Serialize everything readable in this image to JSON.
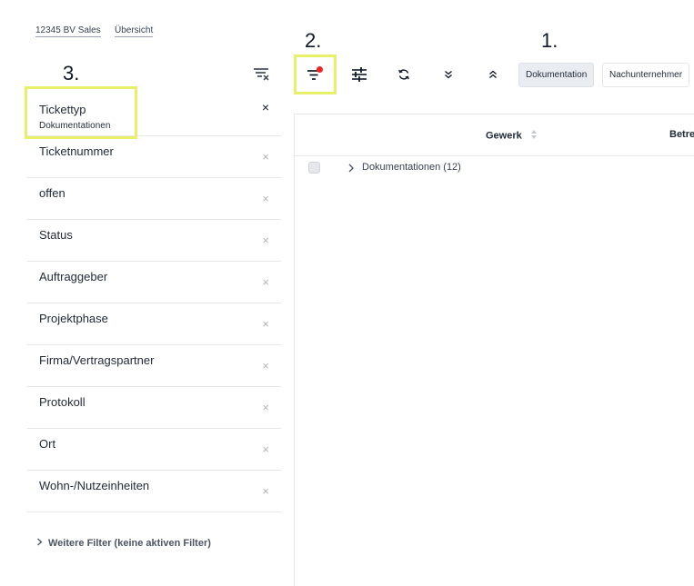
{
  "breadcrumb": [
    "12345 BV Sales",
    "Übersicht"
  ],
  "annotations": {
    "one": "1.",
    "two": "2.",
    "three": "3."
  },
  "filters": [
    {
      "label": "Tickettyp",
      "value": "Dokumentationen",
      "active": true
    },
    {
      "label": "Ticketnummer"
    },
    {
      "label": "offen"
    },
    {
      "label": "Status"
    },
    {
      "label": "Auftraggeber"
    },
    {
      "label": "Projektphase"
    },
    {
      "label": "Firma/Vertragspartner"
    },
    {
      "label": "Protokoll"
    },
    {
      "label": "Ort"
    },
    {
      "label": "Wohn-/Nutzeinheiten"
    }
  ],
  "remove_glyph": "×",
  "more_filters": "Weitere Filter (keine aktiven Filter)",
  "tabs": [
    "Dokumentation",
    "Nachunternehmer"
  ],
  "table": {
    "columns": [
      "Gewerk",
      "Betre"
    ],
    "groups": [
      {
        "label": "Dokumentationen (12)"
      }
    ]
  },
  "colors": {
    "highlight": "#e8f06a",
    "filter_dot": "#ef2424"
  }
}
